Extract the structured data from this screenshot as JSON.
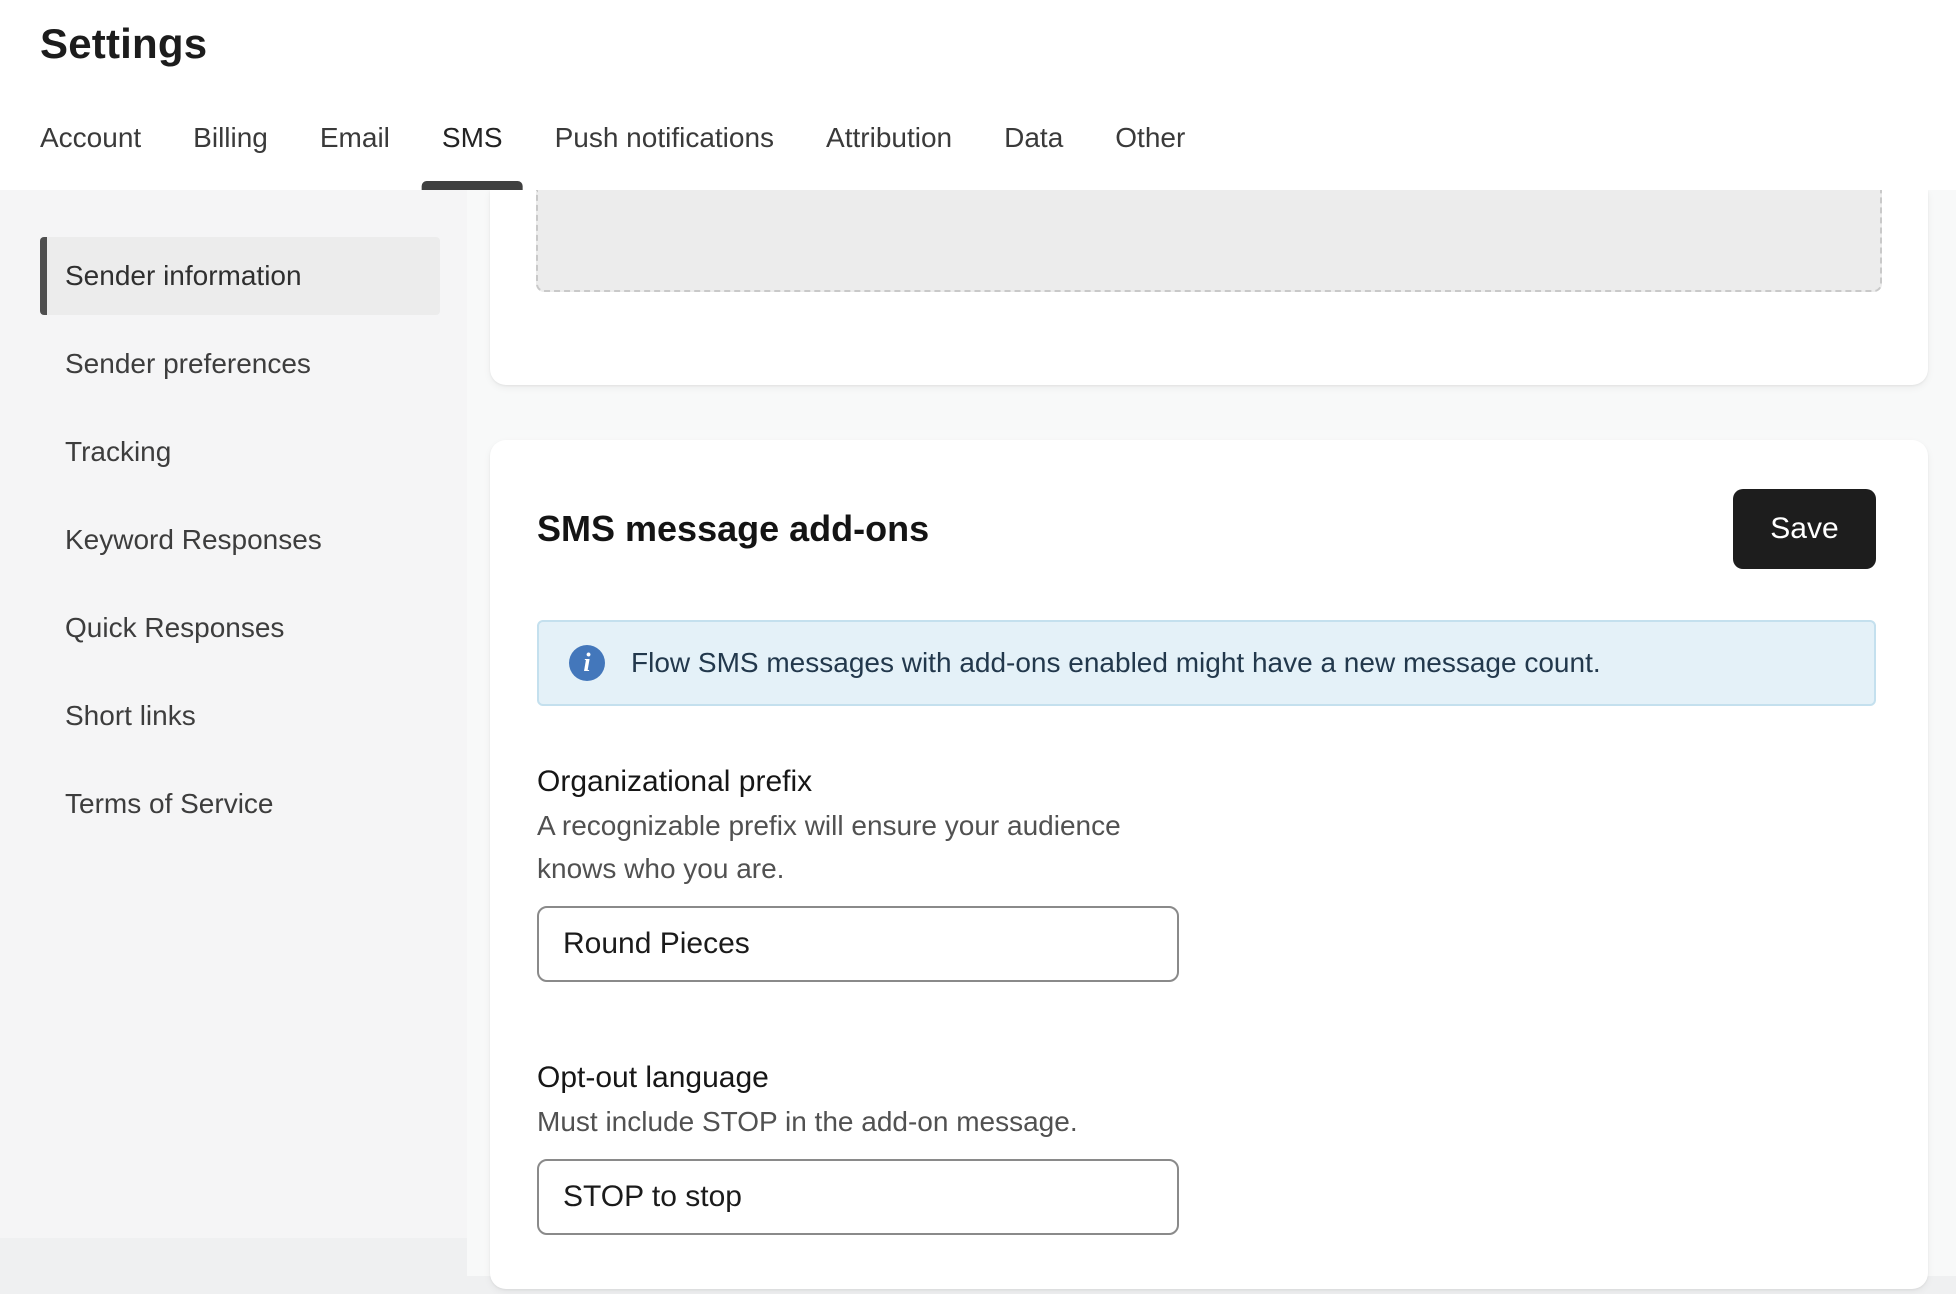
{
  "page": {
    "title": "Settings"
  },
  "tabs": {
    "items": [
      {
        "label": "Account"
      },
      {
        "label": "Billing"
      },
      {
        "label": "Email"
      },
      {
        "label": "SMS",
        "active": true
      },
      {
        "label": "Push notifications"
      },
      {
        "label": "Attribution"
      },
      {
        "label": "Data"
      },
      {
        "label": "Other"
      }
    ]
  },
  "sidebar": {
    "items": [
      {
        "label": "Sender information",
        "active": true
      },
      {
        "label": "Sender preferences"
      },
      {
        "label": "Tracking"
      },
      {
        "label": "Keyword Responses"
      },
      {
        "label": "Quick Responses"
      },
      {
        "label": "Short links"
      },
      {
        "label": "Terms of Service"
      }
    ]
  },
  "cards": {
    "addons": {
      "title": "SMS message add-ons",
      "save_label": "Save",
      "banner": {
        "icon": "info-icon",
        "icon_glyph": "i",
        "text": "Flow SMS messages with add-ons enabled might have a new message count."
      },
      "fields": [
        {
          "label": "Organizational prefix",
          "help": "A recognizable prefix will ensure your audience knows who you are.",
          "value": "Round Pieces"
        },
        {
          "label": "Opt-out language",
          "help": "Must include STOP in the add-on message.",
          "value": "STOP to stop"
        }
      ]
    }
  },
  "colors": {
    "accent_dark": "#1d1d1d",
    "active_tab_underline": "#3f4040",
    "banner_bg": "#e4f1f8",
    "banner_border": "#c4e0ee",
    "banner_text": "#22384c",
    "info_icon_bg": "#4377bb",
    "sidebar_active_bg": "#ececec",
    "sidebar_accent": "#4f4f4f"
  }
}
